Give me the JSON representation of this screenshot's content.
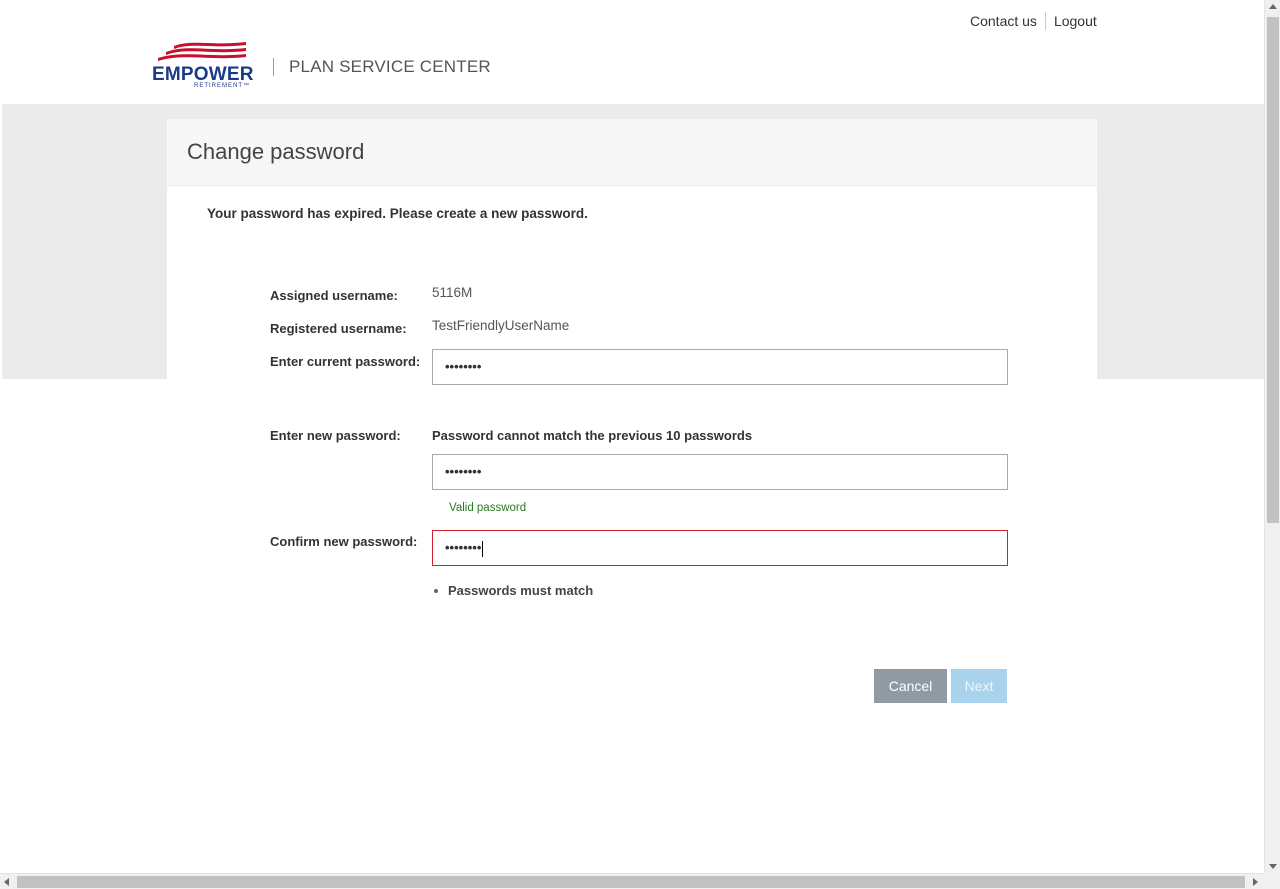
{
  "header": {
    "contact_label": "Contact us",
    "logout_label": "Logout",
    "logo_word": "EMPOWER",
    "logo_sub": "RETIREMENT™",
    "title": "PLAN SERVICE CENTER"
  },
  "card": {
    "title": "Change password",
    "intro": "Your password has expired. Please create a new password."
  },
  "form": {
    "assigned_label": "Assigned username:",
    "assigned_value": "5116M",
    "registered_label": "Registered username:",
    "registered_value": "TestFriendlyUserName",
    "current_label": "Enter current password:",
    "current_mask": "••••••••",
    "new_label": "Enter new password:",
    "new_hint": "Password cannot match the previous 10 passwords",
    "new_mask": "••••••••",
    "new_status": "Valid password",
    "confirm_label": "Confirm new password:",
    "confirm_mask": "••••••••",
    "confirm_error": "Passwords must match"
  },
  "buttons": {
    "cancel": "Cancel",
    "next": "Next"
  },
  "colors": {
    "brand_blue": "#1b3a8a",
    "brand_red": "#c8102e",
    "error_border": "#d0202e",
    "valid_text": "#2a7a1f",
    "cancel_bg": "#8f9aa3",
    "next_bg_disabled": "#a9d2ec"
  }
}
